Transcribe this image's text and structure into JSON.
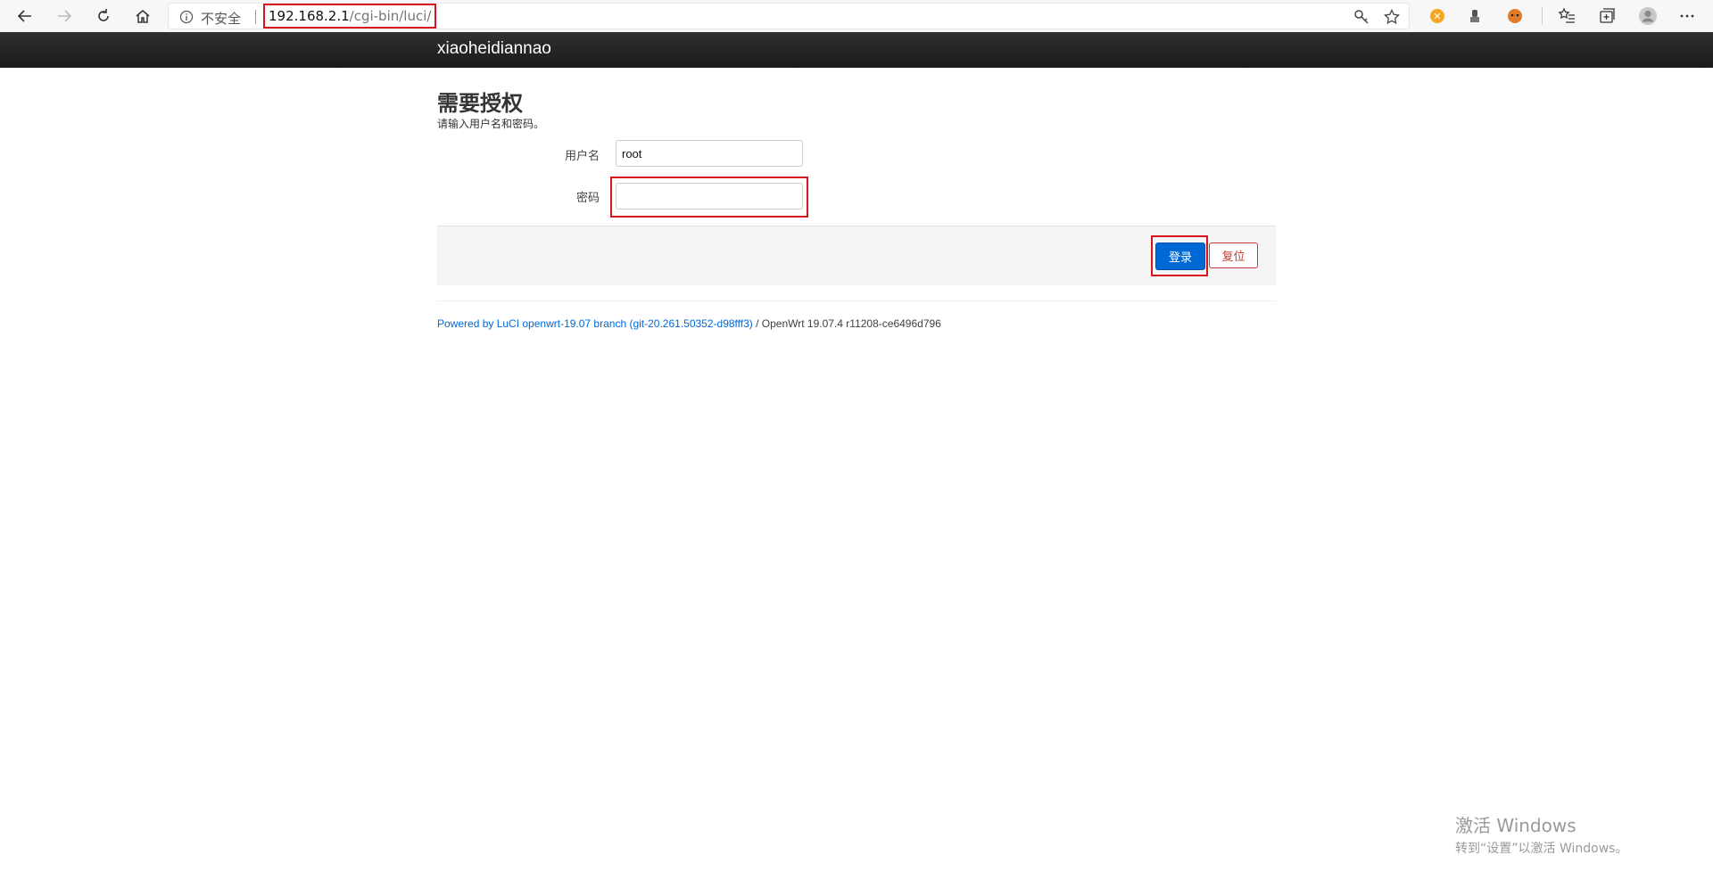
{
  "browser": {
    "insecure_label": "不安全",
    "url_host": "192.168.2.1",
    "url_path": "/cgi-bin/luci/"
  },
  "header": {
    "brand": "xiaoheidiannao"
  },
  "login": {
    "title": "需要授权",
    "description": "请输入用户名和密码。",
    "username_label": "用户名",
    "username_value": "root",
    "password_label": "密码",
    "password_value": "",
    "login_button": "登录",
    "reset_button": "复位"
  },
  "footer": {
    "link_text": "Powered by LuCI openwrt-19.07 branch (git-20.261.50352-d98fff3)",
    "version_text": " / OpenWrt 19.07.4 r11208-ce6496d796"
  },
  "watermark": {
    "title": "激活 Windows",
    "subtitle": "转到“设置”以激活 Windows。"
  },
  "colors": {
    "header_bg": "#1f1f1f",
    "primary_button": "#0069d6",
    "reset_button": "#c43c35",
    "highlight": "#d9141c",
    "link": "#0069d6"
  }
}
